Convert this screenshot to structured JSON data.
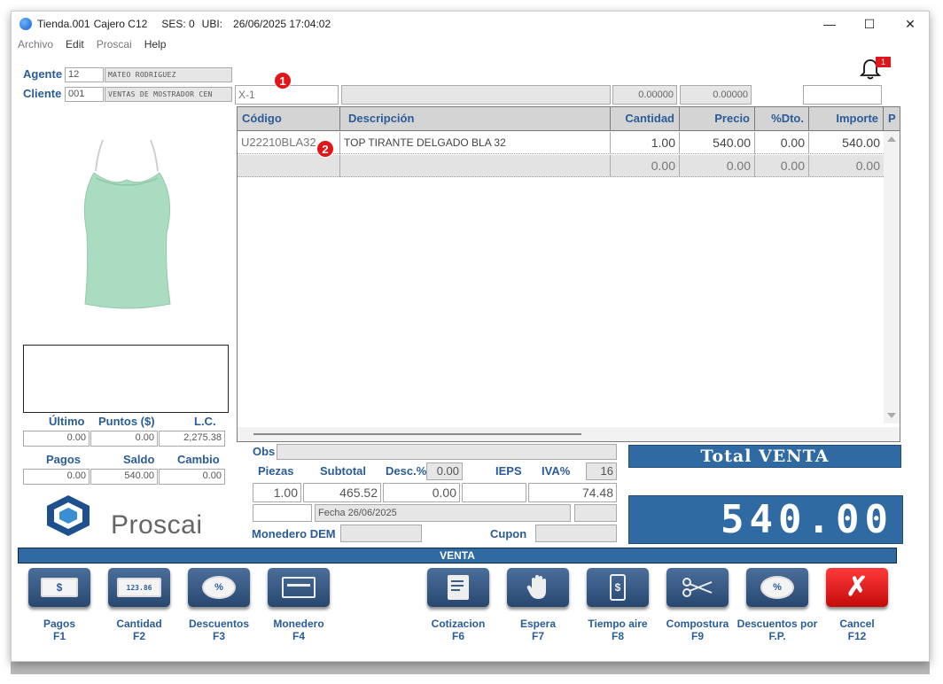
{
  "titlebar": {
    "store": "Tienda.001",
    "cashier": "Cajero C12",
    "session": "SES: 0",
    "ubi": "UBI:",
    "datetime": "26/06/2025 17:04:02",
    "min_glyph": "—",
    "max_glyph": "☐",
    "close_glyph": "✕"
  },
  "menu": [
    "Archivo",
    "Edit",
    "Proscai",
    "Help"
  ],
  "customer": {
    "agente_label": "Agente",
    "agente_code": "12",
    "agente_name": "MATEO RODRIGUEZ",
    "cliente_label": "Cliente",
    "cliente_code": "001",
    "cliente_name": "VENTAS DE MOSTRADOR CEN"
  },
  "scan": {
    "value": "X-1",
    "field2": "0.00000",
    "field3": "0.00000"
  },
  "notifications": {
    "count": "1"
  },
  "badges": {
    "one": "1",
    "two": "2"
  },
  "grid": {
    "columns": [
      "Código",
      "Descripción",
      "Cantidad",
      "Precio",
      "%Dto.",
      "Importe",
      "P"
    ],
    "rows": [
      {
        "codigo": "U22210BLA32",
        "descripcion": "TOP TIRANTE DELGADO BLA 32",
        "cantidad": "1.00",
        "precio": "540.00",
        "dto": "0.00",
        "importe": "540.00"
      },
      {
        "codigo": "",
        "descripcion": "",
        "cantidad": "0.00",
        "precio": "0.00",
        "dto": "0.00",
        "importe": "0.00"
      }
    ]
  },
  "stats": {
    "ultimo_label": "Último",
    "puntos_label": "Puntos ($)",
    "lc_label": "L.C.",
    "ultimo": "0.00",
    "puntos": "0.00",
    "lc": "2,275.38",
    "pagos_label": "Pagos",
    "saldo_label": "Saldo",
    "cambio_label": "Cambio",
    "pagos": "0.00",
    "saldo": "540.00",
    "cambio": "0.00"
  },
  "logo": {
    "text": "Proscai"
  },
  "summary": {
    "obs_label": "Obs",
    "piezas_label": "Piezas",
    "subtotal_label": "Subtotal",
    "desc_label": "Desc.%",
    "desc_pct": "0.00",
    "ieps_label": "IEPS",
    "iva_label": "IVA%",
    "iva_pct": "16",
    "piezas": "1.00",
    "subtotal": "465.52",
    "descuento": "0.00",
    "ieps": "",
    "iva": "74.48",
    "fecha": "Fecha 26/06/2025",
    "monedero_label": "Monedero DEM",
    "cupon_label": "Cupon"
  },
  "total": {
    "label": "Total VENTA",
    "amount": "540.00"
  },
  "mode_bar": "VENTA",
  "fkeys": [
    {
      "name": "Pagos",
      "key": "F1",
      "icon": "$"
    },
    {
      "name": "Cantidad",
      "key": "F2",
      "icon": "123.86"
    },
    {
      "name": "Descuentos",
      "key": "F3",
      "icon": "%"
    },
    {
      "name": "Monedero",
      "key": "F4",
      "icon": "card"
    },
    {
      "name": "Cotizacion",
      "key": "F6",
      "icon": "quote"
    },
    {
      "name": "Espera",
      "key": "F7",
      "icon": "hand"
    },
    {
      "name": "Tiempo aire",
      "key": "F8",
      "icon": "phone"
    },
    {
      "name": "Compostura",
      "key": "F9",
      "icon": "scissors"
    },
    {
      "name": "Descuentos por",
      "key": "F.P.",
      "icon": "%"
    },
    {
      "name": "Cancel",
      "key": "F12",
      "icon": "✗"
    }
  ],
  "icons": {
    "app": "globe-icon",
    "notify": "bell-icon",
    "product": "tank-top-image"
  },
  "colors": {
    "accent": "#2f6aa3",
    "label": "#2a5c98",
    "badge": "#e0161b",
    "cancel": "#e01b1b"
  }
}
